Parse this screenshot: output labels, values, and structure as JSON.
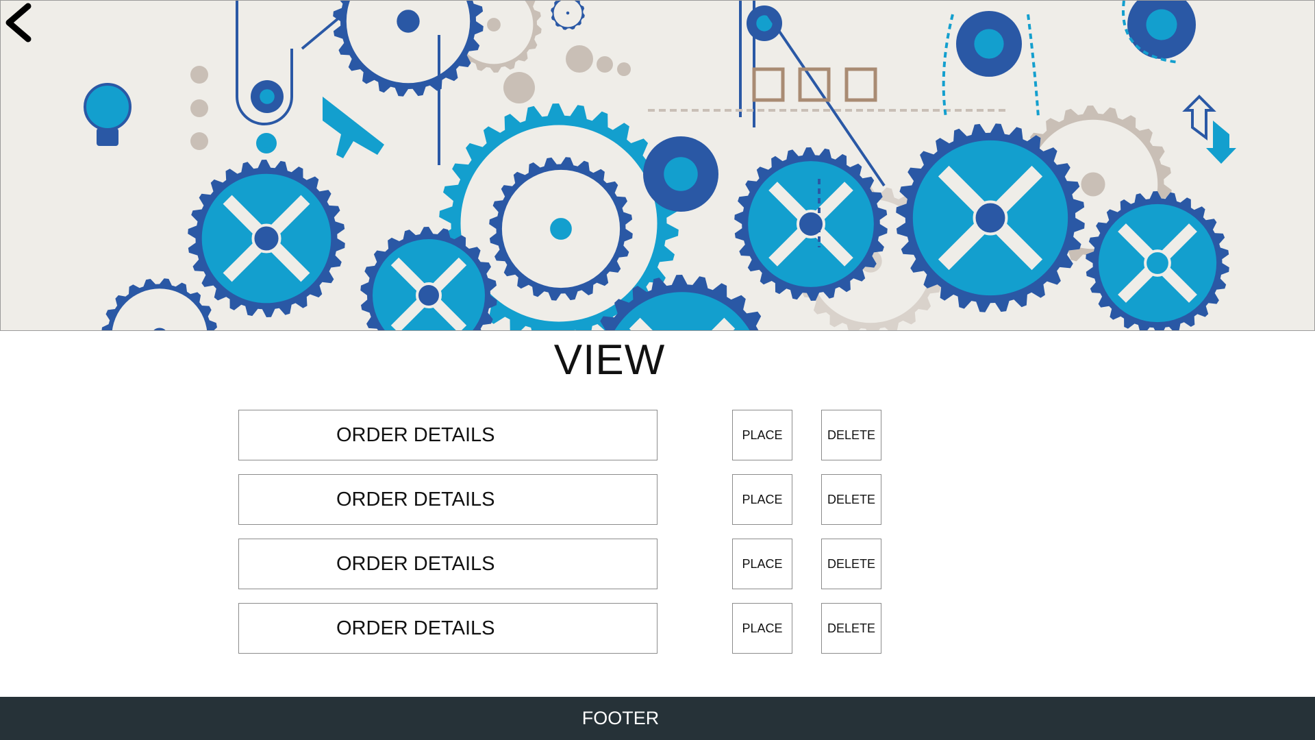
{
  "header": {
    "back_icon": "chevron-left-icon",
    "banner_image": "mechanical-gears-illustration",
    "colors": {
      "dark_blue": "#2a58a5",
      "light_blue": "#139fce",
      "beige": "#efede8",
      "tan": "#c9bfb6"
    }
  },
  "page": {
    "title": "VIEW"
  },
  "orders": [
    {
      "label": "ORDER DETAILS",
      "place_label": "PLACE",
      "delete_label": "DELETE"
    },
    {
      "label": "ORDER DETAILS",
      "place_label": "PLACE",
      "delete_label": "DELETE"
    },
    {
      "label": "ORDER DETAILS",
      "place_label": "PLACE",
      "delete_label": "DELETE"
    },
    {
      "label": "ORDER DETAILS",
      "place_label": "PLACE",
      "delete_label": "DELETE"
    }
  ],
  "footer": {
    "label": "FOOTER",
    "background": "#263238"
  }
}
